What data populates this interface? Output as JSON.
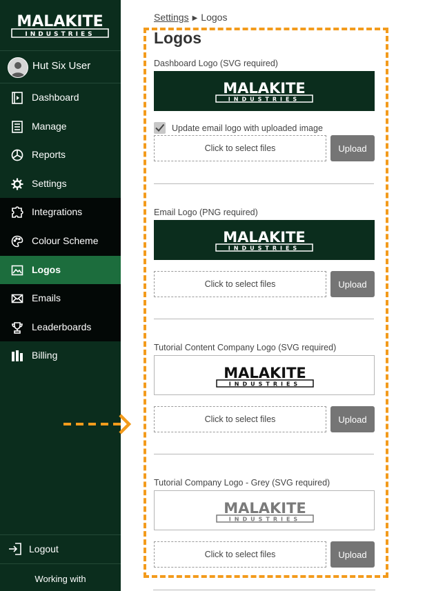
{
  "brand": {
    "name": "MALAKITE",
    "sub": "INDUSTRIES"
  },
  "user": {
    "name": "Hut Six User"
  },
  "nav": [
    {
      "label": "Dashboard",
      "icon": "film-icon"
    },
    {
      "label": "Manage",
      "icon": "list-icon"
    },
    {
      "label": "Reports",
      "icon": "pie-chart-icon"
    },
    {
      "label": "Settings",
      "icon": "gear-icon"
    },
    {
      "label": "Integrations",
      "icon": "puzzle-icon"
    },
    {
      "label": "Colour Scheme",
      "icon": "palette-icon"
    },
    {
      "label": "Logos",
      "icon": "image-icon",
      "active": true
    },
    {
      "label": "Emails",
      "icon": "envelope-icon"
    },
    {
      "label": "Leaderboards",
      "icon": "trophy-icon"
    },
    {
      "label": "Billing",
      "icon": "billing-icon"
    }
  ],
  "logout": "Logout",
  "working_with": "Working with",
  "breadcrumb": {
    "parent": "Settings",
    "current": "Logos"
  },
  "title": "Logos",
  "dropzone_text": "Click to select files",
  "upload_label": "Upload",
  "checkbox": {
    "label": "Update email logo with uploaded image",
    "checked": true
  },
  "sections": [
    {
      "label": "Dashboard Logo (SVG required)",
      "logo_style": "white-on-dark"
    },
    {
      "label": "Email Logo (PNG required)",
      "logo_style": "white-on-dark"
    },
    {
      "label": "Tutorial Content Company Logo (SVG required)",
      "logo_style": "black-on-white"
    },
    {
      "label": "Tutorial Company Logo - Grey (SVG required)",
      "logo_style": "grey-on-white"
    }
  ],
  "colors": {
    "sidebar_bg": "#0b2d1d",
    "active_item": "#1c6d3d",
    "annotation": "#f39b1c",
    "upload_button": "#757575"
  }
}
